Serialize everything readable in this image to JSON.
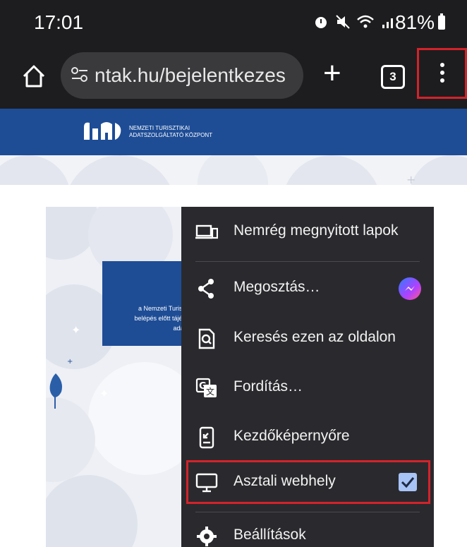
{
  "status_bar": {
    "time": "17:01",
    "icons": [
      "alarm-icon",
      "mute-icon",
      "wifi-icon",
      "signal-icon"
    ],
    "battery": "81%"
  },
  "browser": {
    "url": "ntak.hu/bejelentkezes",
    "tab_count": "3",
    "home_icon": "home-icon",
    "new_tab_icon": "plus-icon",
    "menu_icon": "three-dot-menu-icon"
  },
  "site": {
    "logo_line1": "NEMZETI TURISZTIKAI",
    "logo_line2": "ADATSZOLGÁLTATÓ KÖZPONT",
    "banner_color": "#1e4d96",
    "info_lines": [
      "a Nemzeti Turisz",
      "belépés előtt tájék",
      "adat"
    ]
  },
  "menu": {
    "items": [
      {
        "label": "Nemrég megnyitott lapok",
        "icon": "recent-tabs-icon"
      },
      {
        "label": "Megosztás…",
        "icon": "share-icon",
        "badge_icon": "messenger-icon"
      },
      {
        "label": "Keresés ezen az oldalon",
        "icon": "find-in-page-icon"
      },
      {
        "label": "Fordítás…",
        "icon": "translate-icon"
      },
      {
        "label": "Kezdőképernyőre",
        "icon": "add-to-home-icon"
      },
      {
        "label": "Asztali webhely",
        "icon": "desktop-icon",
        "checked": true
      },
      {
        "label": "Beállítások",
        "icon": "settings-icon"
      }
    ]
  },
  "colors": {
    "highlight": "#d3232a",
    "menu_bg": "#2a2a2e",
    "toolbar_bg": "#1d1d1f"
  }
}
